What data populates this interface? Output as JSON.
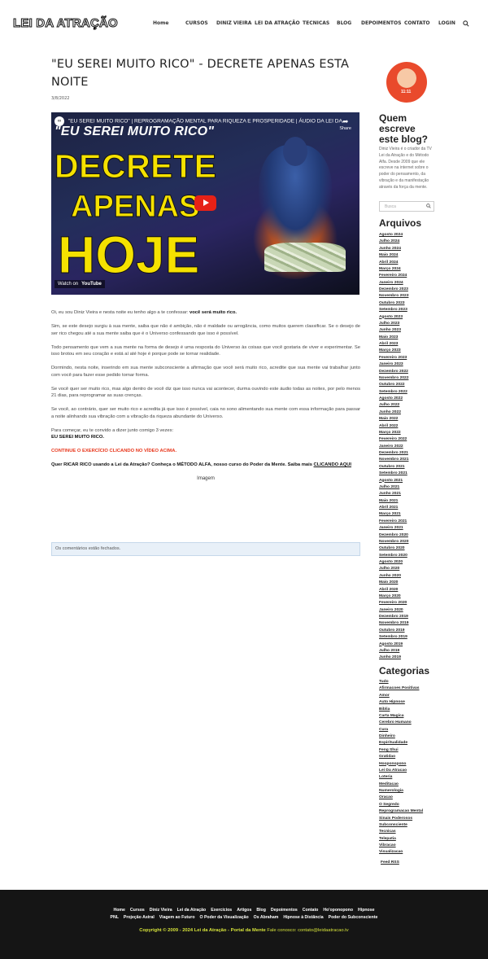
{
  "header": {
    "logo": "LEI DA ATRAÇÃO",
    "nav": [
      "Home",
      "CURSOS",
      "DINIZ VIEIRA",
      "LEI DA ATRAÇÃO",
      "TECNICAS",
      "BLOG",
      "DEPOIMENTOS",
      "CONTATO",
      "LOGIN"
    ]
  },
  "post": {
    "title": "\"EU SEREI MUITO RICO\" - DECRETE APENAS ESTA NOITE",
    "date": "3/8/2022",
    "video": {
      "top_title": "\"EU SEREI MUITO RICO\" | REPROGRAMAÇÃO MENTAL PARA RIQUEZA E PROSPERIDADE | ÁUDIO DA LEI DA...",
      "share": "Share",
      "thumb_subtitle": "\"EU SEREI MUITO RICO\"",
      "thumb_line1": "DECRETE",
      "thumb_line2": "APENAS",
      "thumb_line3": "HOJE",
      "watch_on": "Watch on",
      "youtube": "YouTube"
    },
    "p1_text": "Oi, eu sou Diniz Vieira e nesta noite eu tenho algo a te confessar: ",
    "p1_bold": "você será muito rico.",
    "p2": "Sim, se este desejo surgiu à sua mente, saiba que não é ambição, não é maldade ou arrogância, como muitos querem classificar. Se o desejo de ser rico chegou até a sua mente saiba que é o Universo confessando que isso é possível.",
    "p3": "Todo pensamento que vem a sua mente na forma de desejo é uma resposta do Universo às coisas que você gostaria de viver e experimentar. Se isso brotou em seu coração e está aí até hoje é porque pode se tornar realidade.",
    "p4": "Dormindo, nesta noite, inserindo em sua mente subconsciente a afirmação que você será muito rico, acredite que sua mente vai trabalhar junto com você para fazer esse pedido tornar forma.",
    "p5": "Se você quer ser muito rico, mas algo dentro de você diz que isso nunca vai acontecer, durma ouvindo este áudio todas as noites, por pelo menos 21 dias, para reprogramar as suas crenças.",
    "p6": "Se você, ao contrário, quer ser muito rico e acredita já que isso é possível, caia no sono alimentando sua mente com essa informação para passar a noite alinhando sua vibração com a vibração da riqueza abundante do Universo.",
    "p7_a": "Para começar, eu te convido a dizer junto comigo 3 vezes:",
    "p7_b": "EU SEREI MUITO RICO.",
    "cta_red": "CONTINUE O EXERCÍCIO CLICANDO NO VÍDEO ACIMA.",
    "promo_text": "Quer RICAR RICO usando a Lei da Atração? Conheça o MÉTODO ALFA, nosso curso do Poder da Mente. Saiba mais ",
    "promo_link": "CLICANDO AQUI",
    "image_alt": "Imagem",
    "comments_closed": "Os comentários estão fechados."
  },
  "sidebar": {
    "who_heading": "Quem escreve este blog?",
    "who_text": "Diniz Vieira é o criador da TV Lei da Atração e do Método Alfa. Desde 2009 que ele escreve na internet sobre o poder do pensamento, da vibração e da manifestação através da força da mente.",
    "search_placeholder": "Busca",
    "archives_heading": "Arquivos",
    "archives": [
      "Agosto 2024",
      "Julho 2024",
      "Junho 2024",
      "Maio 2024",
      "Abril 2024",
      "Março 2024",
      "Fevereiro 2024",
      "Janeiro 2024",
      "Dezembro 2023",
      "Novembro 2023",
      "Outubro 2023",
      "Setembro 2023",
      "Agosto 2023",
      "Julho 2023",
      "Junho 2023",
      "Maio 2023",
      "Abril 2023",
      "Março 2023",
      "Fevereiro 2023",
      "Janeiro 2023",
      "Dezembro 2022",
      "Novembro 2022",
      "Outubro 2022",
      "Setembro 2022",
      "Agosto 2022",
      "Julho 2022",
      "Junho 2022",
      "Maio 2022",
      "Abril 2022",
      "Março 2022",
      "Fevereiro 2022",
      "Janeiro 2022",
      "Dezembro 2021",
      "Novembro 2021",
      "Outubro 2021",
      "Setembro 2021",
      "Agosto 2021",
      "Julho 2021",
      "Junho 2021",
      "Maio 2021",
      "Abril 2021",
      "Março 2021",
      "Fevereiro 2021",
      "Janeiro 2021",
      "Dezembro 2020",
      "Novembro 2020",
      "Outubro 2020",
      "Setembro 2020",
      "Agosto 2020",
      "Julho 2020",
      "Junho 2020",
      "Maio 2020",
      "Abril 2020",
      "Março 2020",
      "Fevereiro 2020",
      "Janeiro 2020",
      "Dezembro 2019",
      "Novembro 2019",
      "Outubro 2019",
      "Setembro 2019",
      "Agosto 2019",
      "Julho 2019",
      "Junho 2019"
    ],
    "categories_heading": "Categorias",
    "categories": [
      "Tudo",
      "Afirmacoes Positivas",
      "Amor",
      "Auto Hipnose",
      "Biblia",
      "Carta Magica",
      "Cerebro Humano",
      "Cura",
      "Dinheiro",
      "Espiritualidade",
      "Feng Shui",
      "Gratidao",
      "Hooponopono",
      "Lei Da Atracao",
      "Loteria",
      "Meditacao",
      "Numerologia",
      "Oracao",
      "O Segredo",
      "Reprogramacao Mental",
      "Sinais Poderosos",
      "Subconsciente",
      "Tecnicas",
      "Telepatia",
      "Vibracao",
      "Visualizacao"
    ],
    "feed": "Feed RSS"
  },
  "footer": {
    "row1": [
      "Home",
      "Cursos",
      "Diniz Vieira",
      "Lei da Atração",
      "Exercícios",
      "Artigos",
      "Blog",
      "Depoimentos",
      "Contato",
      "Ho'oponopono",
      "Hipnose"
    ],
    "row2": [
      "PNL",
      "Projeção Astral",
      "Viagem ao Futuro",
      "O Poder da Visualização",
      "Os Abraham",
      "Hipnose à Distância",
      "Poder do Subconsciente"
    ],
    "copyright": "Copyright © 2009 - 2024 Lei da Atração - Portal da Mente",
    "contact": " Fale conosco: contato@leidaatracao.tv"
  }
}
